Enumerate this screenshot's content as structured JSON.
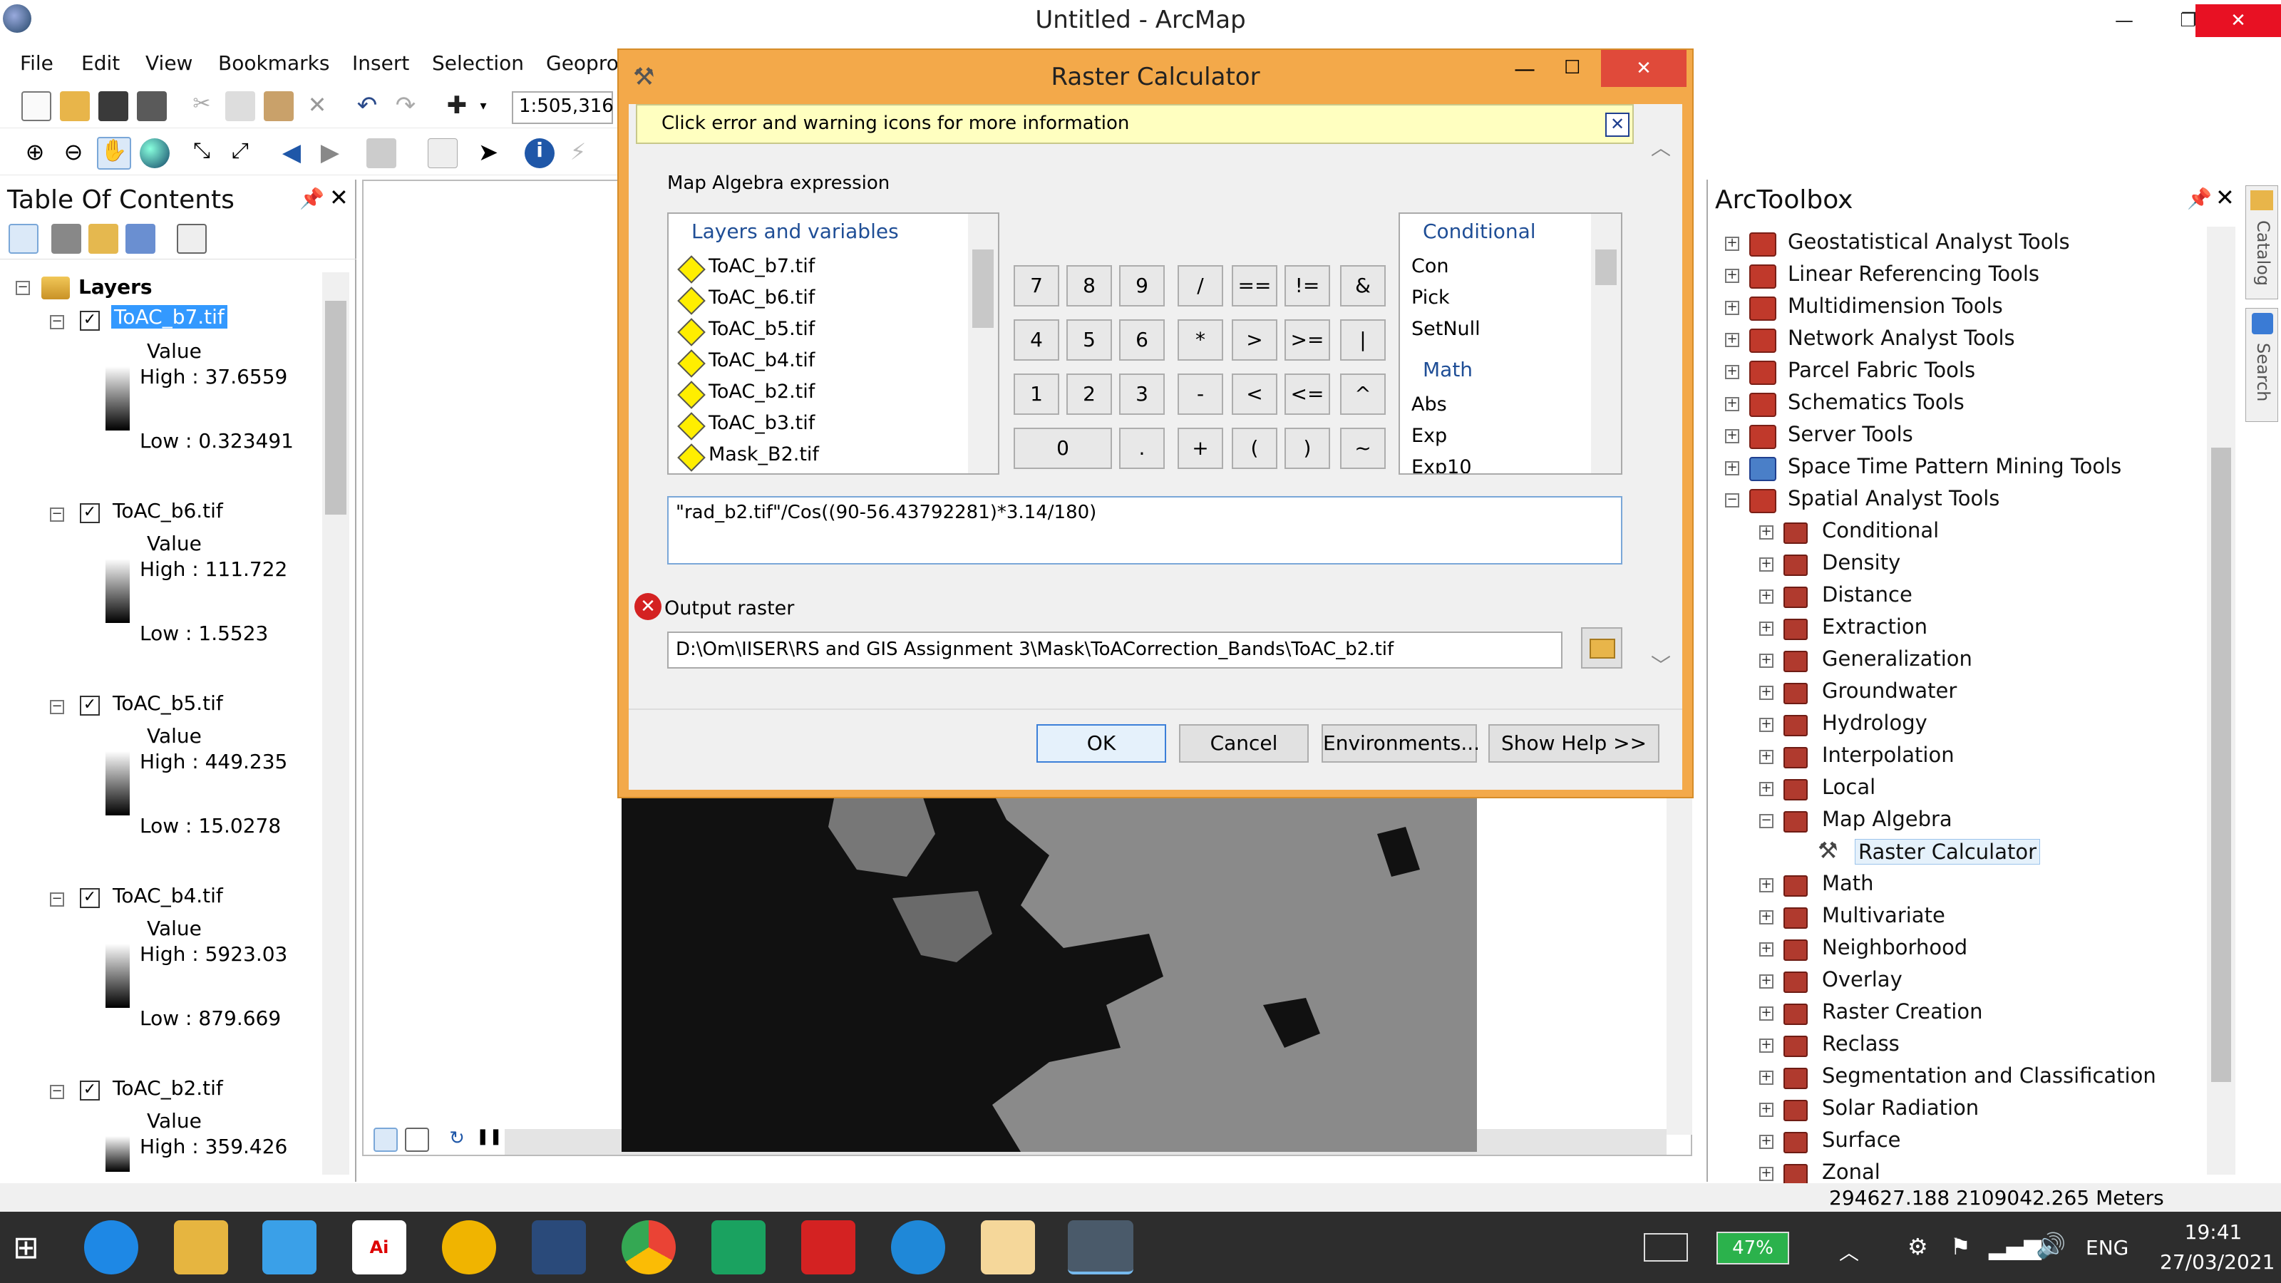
{
  "window": {
    "title": "Untitled - ArcMap"
  },
  "menu": [
    "File",
    "Edit",
    "View",
    "Bookmarks",
    "Insert",
    "Selection",
    "Geopro"
  ],
  "toolbar": {
    "scale": "1:505,316"
  },
  "toc": {
    "title": "Table Of Contents",
    "root": "Layers",
    "layers": [
      {
        "name": "ToAC_b7.tif",
        "value": "Value",
        "high": "High : 37.6559",
        "low": "Low : 0.323491"
      },
      {
        "name": "ToAC_b6.tif",
        "value": "Value",
        "high": "High : 111.722",
        "low": "Low : 1.5523"
      },
      {
        "name": "ToAC_b5.tif",
        "value": "Value",
        "high": "High : 449.235",
        "low": "Low : 15.0278"
      },
      {
        "name": "ToAC_b4.tif",
        "value": "Value",
        "high": "High : 5923.03",
        "low": "Low : 879.669"
      },
      {
        "name": "ToAC_b2.tif",
        "value": "Value",
        "high": "High : 359.426",
        "low": ""
      }
    ]
  },
  "dialog": {
    "title": "Raster Calculator",
    "warning": "Click error and warning icons for more information",
    "expr_label": "Map Algebra expression",
    "layers_header": "Layers and variables",
    "layers": [
      "ToAC_b7.tif",
      "ToAC_b6.tif",
      "ToAC_b5.tif",
      "ToAC_b4.tif",
      "ToAC_b2.tif",
      "ToAC_b3.tif",
      "Mask_B2.tif"
    ],
    "keys": [
      "7",
      "8",
      "9",
      "/",
      "==",
      "!=",
      "&",
      "4",
      "5",
      "6",
      "*",
      ">",
      ">=",
      "|",
      "1",
      "2",
      "3",
      "-",
      "<",
      "<=",
      "^",
      "0",
      ".",
      "+",
      "(",
      ")",
      "~"
    ],
    "func_header1": "Conditional",
    "funcs1": [
      "Con",
      "Pick",
      "SetNull"
    ],
    "func_header2": "Math",
    "funcs2": [
      "Abs",
      "Exp",
      "Exp10"
    ],
    "expression": "\"rad_b2.tif\"/Cos((90-56.43792281)*3.14/180)",
    "output_label": "Output raster",
    "output_path": "D:\\Om\\IISER\\RS and GIS Assignment 3\\Mask\\ToACorrection_Bands\\ToAC_b2.tif",
    "buttons": {
      "ok": "OK",
      "cancel": "Cancel",
      "env": "Environments...",
      "help": "Show Help >>"
    }
  },
  "toolbox": {
    "title": "ArcToolbox",
    "top": [
      "Geostatistical Analyst Tools",
      "Linear Referencing Tools",
      "Multidimension Tools",
      "Network Analyst Tools",
      "Parcel Fabric Tools",
      "Schematics Tools",
      "Server Tools",
      "Space Time Pattern Mining Tools",
      "Spatial Analyst Tools"
    ],
    "spatial": [
      "Conditional",
      "Density",
      "Distance",
      "Extraction",
      "Generalization",
      "Groundwater",
      "Hydrology",
      "Interpolation",
      "Local",
      "Map Algebra"
    ],
    "map_algebra_child": "Raster Calculator",
    "spatial2": [
      "Math",
      "Multivariate",
      "Neighborhood",
      "Overlay",
      "Raster Creation",
      "Reclass",
      "Segmentation and Classification",
      "Solar Radiation",
      "Surface",
      "Zonal"
    ]
  },
  "side_tabs": [
    "Catalog",
    "Search"
  ],
  "status": {
    "coords": "294627.188  2109042.265 Meters"
  },
  "taskbar": {
    "battery": "47%",
    "lang": "ENG",
    "time": "19:41",
    "date": "27/03/2021"
  },
  "colors": {
    "accent": "#f3a94a",
    "selection": "#3399ff",
    "taskbar": "#2d2d2d"
  }
}
